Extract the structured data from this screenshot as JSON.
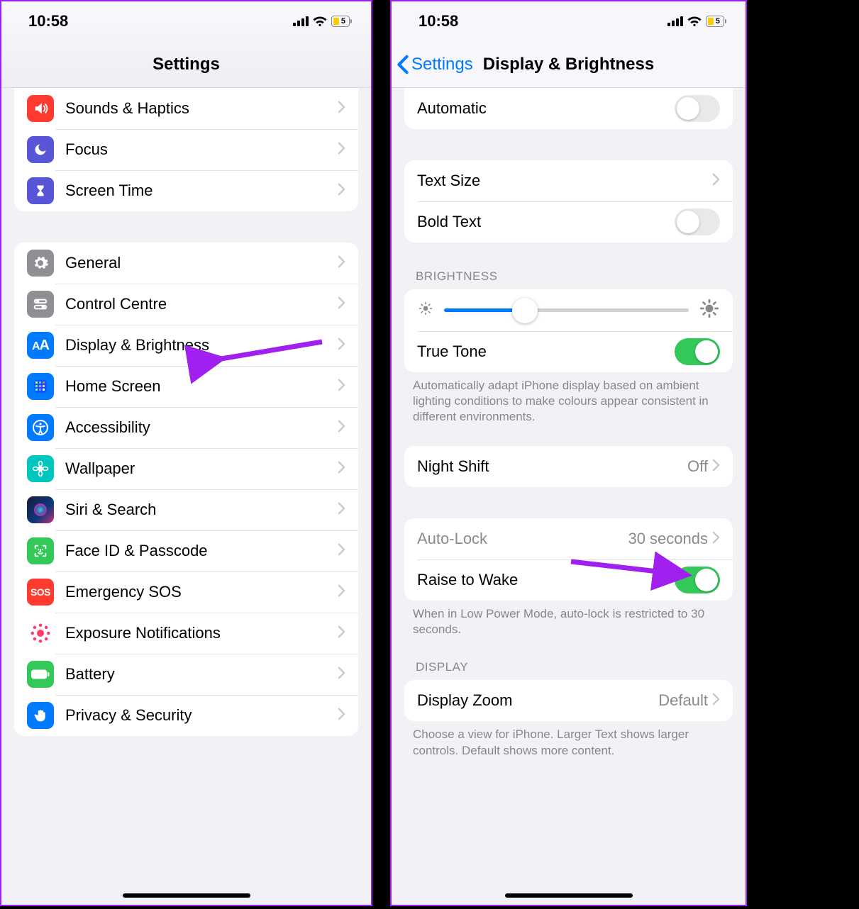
{
  "status": {
    "time": "10:58",
    "battery": "5"
  },
  "left": {
    "title": "Settings",
    "groups": [
      {
        "rows": [
          {
            "id": "sounds",
            "label": "Sounds & Haptics",
            "icon": "speaker",
            "bg": "bg-red"
          },
          {
            "id": "focus",
            "label": "Focus",
            "icon": "moon",
            "bg": "bg-indigo"
          },
          {
            "id": "screen",
            "label": "Screen Time",
            "icon": "hourglass",
            "bg": "bg-indigo"
          }
        ]
      },
      {
        "rows": [
          {
            "id": "general",
            "label": "General",
            "icon": "gear",
            "bg": "bg-grey"
          },
          {
            "id": "control",
            "label": "Control Centre",
            "icon": "switches",
            "bg": "bg-grey"
          },
          {
            "id": "display",
            "label": "Display & Brightness",
            "icon": "AA",
            "bg": "bg-blue"
          },
          {
            "id": "home",
            "label": "Home Screen",
            "icon": "grid",
            "bg": "bg-blue"
          },
          {
            "id": "access",
            "label": "Accessibility",
            "icon": "access",
            "bg": "bg-blue"
          },
          {
            "id": "wall",
            "label": "Wallpaper",
            "icon": "flower",
            "bg": "bg-cyan"
          },
          {
            "id": "siri",
            "label": "Siri & Search",
            "icon": "siri",
            "bg": "bg-siri"
          },
          {
            "id": "face",
            "label": "Face ID & Passcode",
            "icon": "face",
            "bg": "bg-green"
          },
          {
            "id": "sos",
            "label": "Emergency SOS",
            "icon": "sos",
            "bg": "bg-sos"
          },
          {
            "id": "expo",
            "label": "Exposure Notifications",
            "icon": "expo",
            "bg": "bg-expo"
          },
          {
            "id": "batt",
            "label": "Battery",
            "icon": "battery",
            "bg": "bg-green"
          },
          {
            "id": "priv",
            "label": "Privacy & Security",
            "icon": "hand",
            "bg": "bg-hand"
          }
        ]
      }
    ]
  },
  "right": {
    "back": "Settings",
    "title": "Display & Brightness",
    "automatic": "Automatic",
    "textsize": "Text Size",
    "bold": "Bold Text",
    "brightness_header": "BRIGHTNESS",
    "truetone": "True Tone",
    "truetone_footer": "Automatically adapt iPhone display based on ambient lighting conditions to make colours appear consistent in different environments.",
    "nightshift": "Night Shift",
    "nightshift_value": "Off",
    "autolock": "Auto-Lock",
    "autolock_value": "30 seconds",
    "raise": "Raise to Wake",
    "raise_footer": "When in Low Power Mode, auto-lock is restricted to 30 seconds.",
    "display_header": "DISPLAY",
    "zoom": "Display Zoom",
    "zoom_value": "Default",
    "zoom_footer": "Choose a view for iPhone. Larger Text shows larger controls. Default shows more content."
  }
}
